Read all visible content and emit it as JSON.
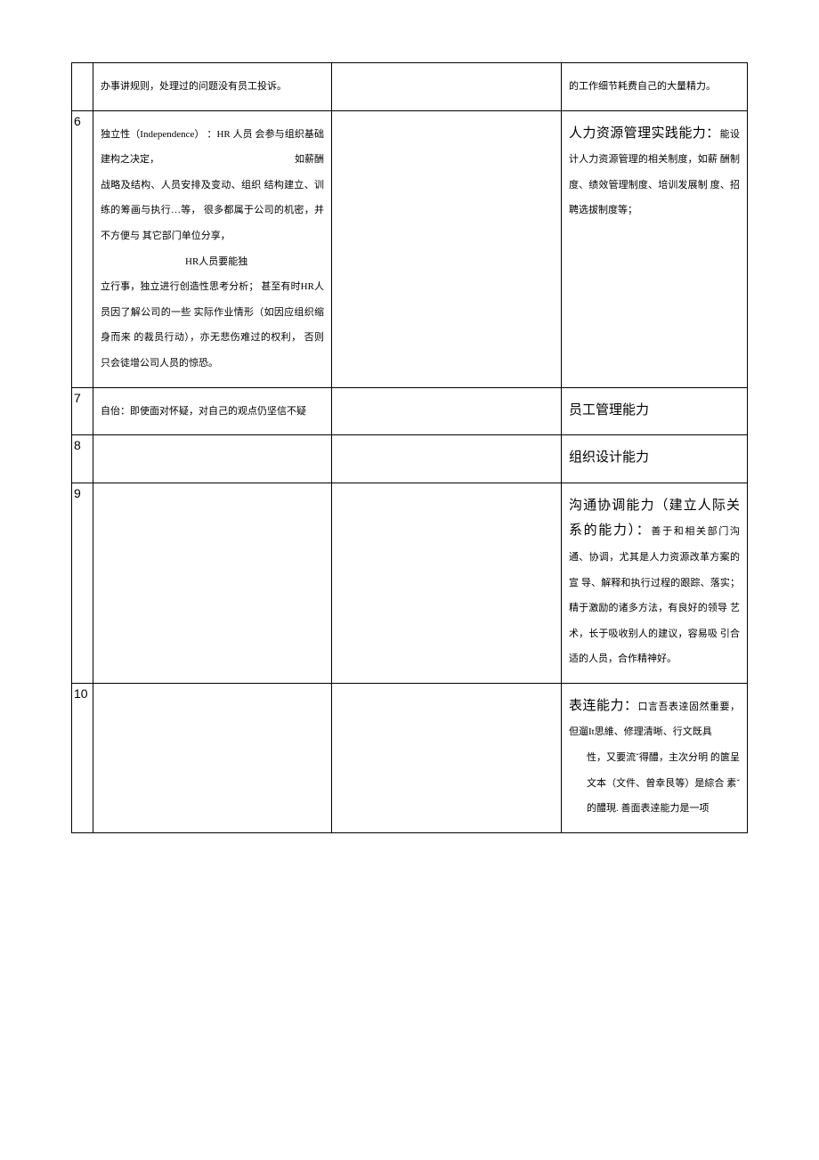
{
  "rows": [
    {
      "num": "",
      "col1": {
        "body": "办事讲规则，处理过的问题没有员工投诉。"
      },
      "col3": {
        "body": "的工作细节耗费自己的大量精力。"
      }
    },
    {
      "num": "6",
      "col1": {
        "body_line1": "独立性（Independence） ：HR 人员 会参与组织基础建构之决定，",
        "right_tag": "如薪酬",
        "body_line2": "战略及结构、人员安排及变动、组织 结构建立、训练的筹画与执行…等， 很多都属于公司的机密，并不方便与 其它部门单位分享，",
        "hr_line": "HR人员要能独",
        "body_line3": "立行事，独立进行创造性思考分析； 甚至有时HR人员因了解公司的一些 实际作业情形（如因应组织缩身而来 的裁员行动），亦无悲伤难过的权利， 否则只会徒增公司人员的惊恐。"
      },
      "col3": {
        "title": "人力资源管理实践能力：",
        "body": "能设计人力资源管理的相关制度，如薪 酬制度、绩效管理制度、培训发展制 度、招聘选拔制度等；"
      }
    },
    {
      "num": "7",
      "col1": {
        "body": "自佁：即使面对怀疑，对自己的观点仍坚信不疑"
      },
      "col3": {
        "title": "员工管理能力"
      }
    },
    {
      "num": "8",
      "col3": {
        "title": "组织设计能力"
      }
    },
    {
      "num": "9",
      "col3": {
        "title": "沟通协调能力（建立人际关系的能力）：",
        "body": "善于和相关部门沟通、协调，尤其是人力资源改革方案的宣 导、解释和执行过程的跟踪、落实； 精于激励的诸多方法，有良好的领导 艺术，长于吸收别人的建议，容易吸 引合适的人员，合作精神好。"
      }
    },
    {
      "num": "10",
      "col3": {
        "title": "表连能力：",
        "body": "口言吾表逹固然重要，但遛It思維、修理清晰、行文既具",
        "body_sub": "性，又要流ˇ得醴，主次分明 的篋呈文本（文件、曾幸艮等）是綜合 素ˇ的醴現. 善面表逹能力是一项"
      }
    }
  ]
}
